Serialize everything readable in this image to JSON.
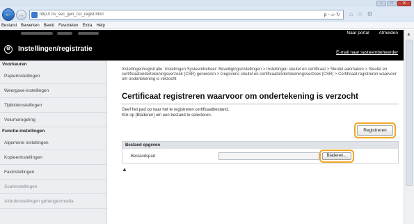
{
  "browser": {
    "url": "http://                      /rs_sec_gen_csr_regist.html",
    "address_tools": "ρ - ▱ ↻",
    "menu": [
      "Bestand",
      "Bewerken",
      "Beeld",
      "Favorieten",
      "Extra",
      "Help"
    ],
    "window_buttons": [
      "−",
      "□",
      "✕"
    ]
  },
  "header": {
    "portal_link": "Naar portal",
    "logout_link": "Afmelden",
    "title": "Instellingen/registratie",
    "email_link": "E-mail naar systeembeheerder"
  },
  "sidebar": {
    "sections": [
      {
        "title": "Voorkeuren",
        "items": [
          "Papierinstellingen",
          "Weergave-instellingen",
          "Tijdklokinstellingen",
          "Volumeregeling"
        ]
      },
      {
        "title": "Functie-instellingen",
        "items": [
          "Algemene instellingen",
          "Kopieerinstellingen",
          "Faxinstellingen",
          "Scaninstellingen",
          "Afdrukinstellingen geheugenmedia"
        ]
      }
    ]
  },
  "main": {
    "breadcrumb": "Instellingen/registratie: Instellingen Systeembeheer: Beveiligingsinstellingen > Instellingen sleutel en certificaat > Sleutel aanmaken > Sleutel en certificaatondertekeningsverzoek (CSR) genereren > Gegevens sleutel en certificaatondertekeningsverzoek (CSR) > Certificaat registreren waarvoor om ondertekening is verzocht",
    "page_title": "Certificaat registreren waarvoor om ondertekening is verzocht",
    "instruction_1": "Geef het pad op naar het te registreren certificaatbestand.",
    "instruction_2": "Klik op [Bladeren] om een bestand te selecteren.",
    "register_button": "Registreren",
    "file_panel": {
      "heading": "Bestand opgeven",
      "path_label": "Bestandspad",
      "path_value": "",
      "browse_button": "Bladeren..."
    },
    "top_icon": "▲"
  },
  "accent": "#f0a727"
}
